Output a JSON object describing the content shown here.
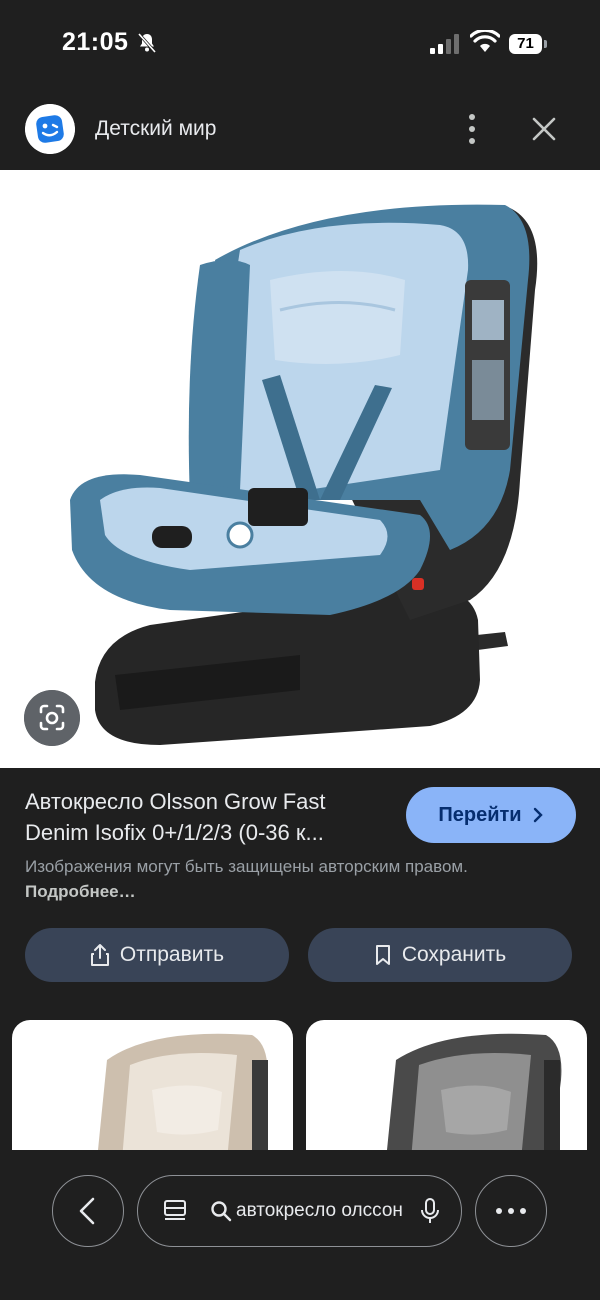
{
  "status_bar": {
    "time": "21:05",
    "battery": "71",
    "icons": [
      "bell-off-icon",
      "signal-icon",
      "wifi-icon",
      "battery-icon"
    ]
  },
  "header": {
    "site_name": "Детский мир",
    "icons": [
      "site-logo-icon",
      "more-vert-icon",
      "close-icon"
    ]
  },
  "product": {
    "title_line1": "Автокресло Olsson Grow Fast",
    "title_line2": "Denim Isofix 0+/1/2/3 (0-36 к...",
    "go_label": "Перейти",
    "copyright_text": "Изображения могут быть защищены авторским правом.",
    "more_link": "Подробнее…"
  },
  "actions": {
    "share_label": "Отправить",
    "save_label": "Сохранить"
  },
  "bottom_nav": {
    "search_query": "автокресло олссон",
    "icons": [
      "back-icon",
      "tabs-icon",
      "search-icon",
      "mic-icon",
      "more-horiz-icon"
    ]
  },
  "colors": {
    "background": "#1f1f1f",
    "accent_button": "#8ab4f8",
    "secondary_button": "#394457",
    "seat_blue": "#4a7fa0",
    "seat_light": "#bcd6ec"
  }
}
